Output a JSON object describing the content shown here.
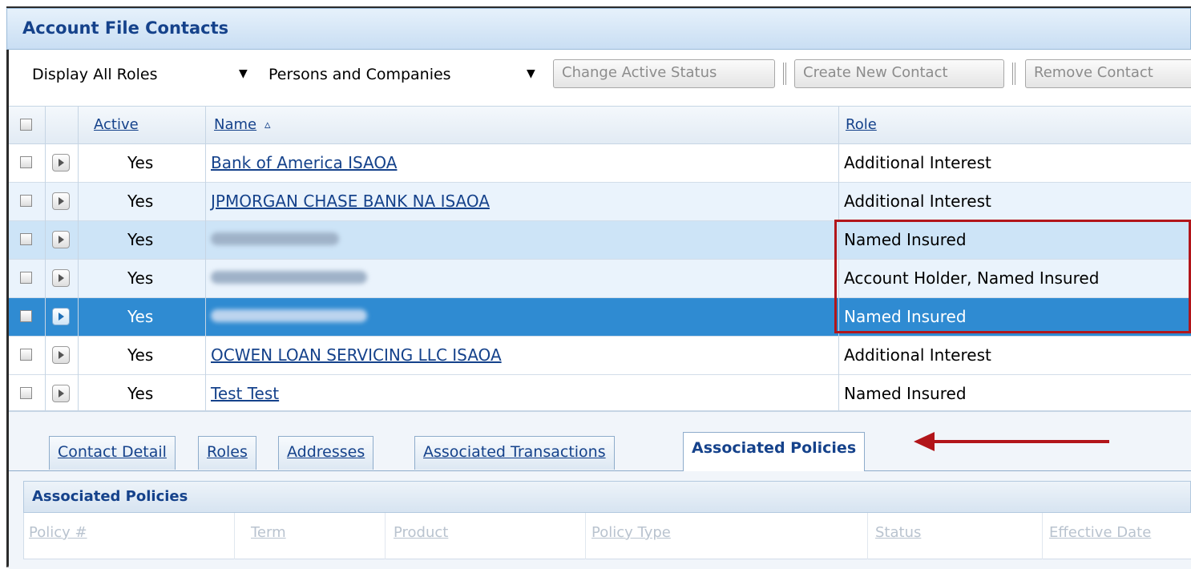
{
  "panel": {
    "title": "Account File Contacts"
  },
  "toolbar": {
    "roles_filter": "Display All Roles",
    "type_filter": "Persons and Companies",
    "change_status_label": "Change Active Status",
    "create_contact_label": "Create New Contact",
    "remove_contact_label": "Remove Contact"
  },
  "grid": {
    "headers": {
      "active": "Active",
      "name": "Name",
      "sort_indicator": "▵",
      "role": "Role"
    },
    "rows": [
      {
        "active": "Yes",
        "name": "Bank of America ISAOA",
        "role": "Additional Interest"
      },
      {
        "active": "Yes",
        "name": "JPMORGAN CHASE BANK NA ISAOA",
        "role": "Additional Interest"
      },
      {
        "active": "Yes",
        "name": "",
        "role": "Named Insured"
      },
      {
        "active": "Yes",
        "name": "",
        "role": "Account Holder, Named Insured"
      },
      {
        "active": "Yes",
        "name": "",
        "role": "Named Insured"
      },
      {
        "active": "Yes",
        "name": "OCWEN LOAN SERVICING LLC ISAOA",
        "role": "Additional Interest"
      },
      {
        "active": "Yes",
        "name": "Test Test",
        "role": "Named Insured"
      }
    ]
  },
  "tabs": [
    {
      "label": "Contact Detail"
    },
    {
      "label": "Roles"
    },
    {
      "label": "Addresses"
    },
    {
      "label": "Associated Transactions"
    },
    {
      "label": "Associated Policies"
    }
  ],
  "policies": {
    "title": "Associated Policies",
    "columns": [
      "Policy #",
      "Term",
      "Product",
      "Policy Type",
      "Status",
      "Effective Date"
    ]
  },
  "colors": {
    "accent": "#15428b",
    "selected_row": "#2f8bd2",
    "annotation": "#b2151a"
  }
}
